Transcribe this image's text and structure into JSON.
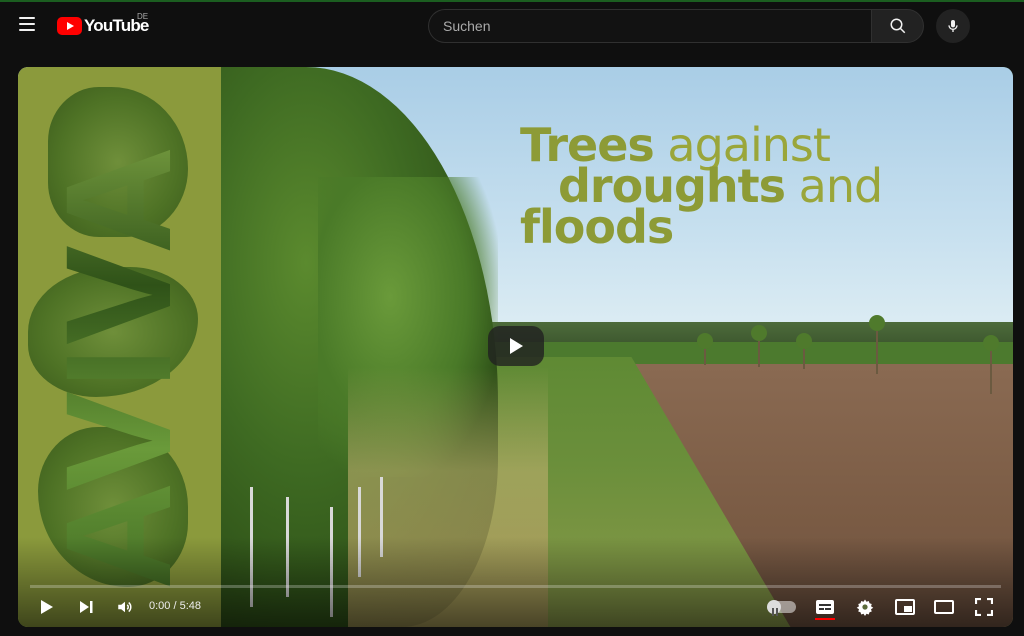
{
  "header": {
    "logo_text": "YouTube",
    "region": "DE",
    "search_placeholder": "Suchen",
    "icons": [
      "menu-icon",
      "search-icon",
      "mic-icon"
    ]
  },
  "video": {
    "side_title": "AVIVA",
    "headline": {
      "line1_bold": "Trees",
      "line1_light": " against",
      "line2_bold": "droughts",
      "line2_light": " and",
      "line3_bold": "floods"
    },
    "progress": 0,
    "time_current": "0:00",
    "time_total": "5:48",
    "time_display": "0:00 / 5:48"
  },
  "colors": {
    "accent_red": "#ff0000",
    "headline_olive": "#8d9b36",
    "panel_olive": "#8b9a3c",
    "background": "#0f0f0f"
  }
}
